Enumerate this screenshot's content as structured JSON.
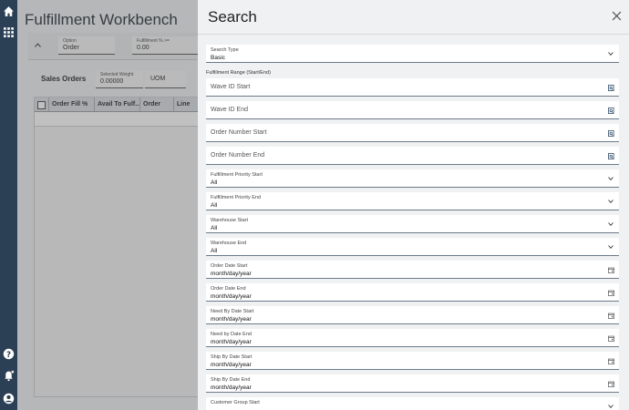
{
  "background": {
    "title": "Fulfillment Workbench",
    "option_label": "Option",
    "option_value": "Order",
    "fill_label": "Fulfillment % >=",
    "fill_value": "0.00",
    "sales_orders": "Sales Orders",
    "selected_weight_label": "Selected Weight",
    "selected_weight_value": "0.00000",
    "uom_label": "UOM",
    "columns": [
      "Order Fill %",
      "Avail To Fulf...",
      "Order",
      "Line"
    ]
  },
  "panel": {
    "title": "Search",
    "search_type": {
      "label": "Search Type",
      "value": "Basic"
    },
    "range_label": "Fulfillment Range (Start/End)",
    "text_fields": [
      "Wave ID Start",
      "Wave ID End",
      "Order Number Start",
      "Order Number End"
    ],
    "selects": [
      {
        "label": "Fulfillment Priority Start",
        "value": "All"
      },
      {
        "label": "Fulfillment Priority End",
        "value": "All"
      },
      {
        "label": "Warehouse Start",
        "value": "All"
      },
      {
        "label": "Warehouse End",
        "value": "All"
      }
    ],
    "dates": [
      {
        "label": "Order Date Start",
        "value": "month/day/year"
      },
      {
        "label": "Order Date End",
        "value": "month/day/year"
      },
      {
        "label": "Need By Date Start",
        "value": "month/day/year"
      },
      {
        "label": "Need by Date End",
        "value": "month/day/year"
      },
      {
        "label": "Ship By Date Start",
        "value": "month/day/year"
      },
      {
        "label": "Ship By Date End",
        "value": "month/day/year"
      }
    ],
    "last_select": {
      "label": "Customer Group Start"
    }
  },
  "icons": {
    "rail": [
      "home-icon",
      "apps-grid-icon",
      "help-icon",
      "notification-bell-icon",
      "user-account-icon"
    ],
    "field_text": "search-lookup-icon",
    "field_date": "calendar-icon",
    "field_select": "chevron-down-icon"
  }
}
